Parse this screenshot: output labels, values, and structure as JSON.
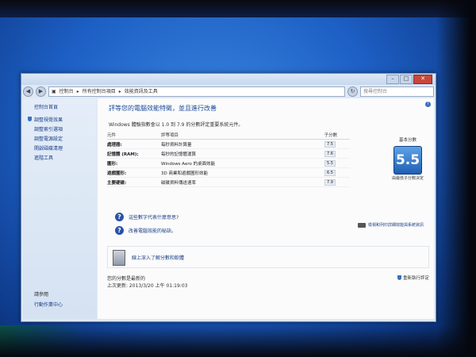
{
  "window": {
    "breadcrumb": [
      "控制台",
      "所有控制台項目",
      "效能資訊及工具"
    ],
    "search_placeholder": "搜尋控制台"
  },
  "sidebar": {
    "home": "控制台首頁",
    "items": [
      {
        "label": "調整視覺效果"
      },
      {
        "label": "調整索引選項"
      },
      {
        "label": "調整電源設定"
      },
      {
        "label": "開啟磁碟清理"
      },
      {
        "label": "進階工具"
      }
    ],
    "see_also": "請參閱",
    "action_center": "行動作業中心"
  },
  "main": {
    "heading": "評等您的電腦效能特徵，並且進行改善",
    "subtitle": "Windows 體驗指數會以 1.0 到 7.9 的分數評定重要系統元件。",
    "table": {
      "headers": {
        "component": "元件",
        "rated": "評等項目",
        "subscore": "子分數",
        "base": "基本分數"
      },
      "rows": [
        {
          "component": "處理器:",
          "desc": "每秒資料計算量",
          "score": "7.5"
        },
        {
          "component": "記憶體 (RAM):",
          "desc": "每秒的記憶體運算",
          "score": "7.6"
        },
        {
          "component": "圖形:",
          "desc": "Windows Aero 的桌面效能",
          "score": "5.5"
        },
        {
          "component": "遊戲圖形:",
          "desc": "3D 商業和遊戲圖形效能",
          "score": "6.5"
        },
        {
          "component": "主要硬碟:",
          "desc": "磁碟資料傳送速率",
          "score": "7.9"
        }
      ],
      "base_score": "5.5",
      "base_caption": "由最低子分數決定"
    },
    "links": {
      "what_means": "這些數字代表什麼意思?",
      "improve": "改善電腦效能的秘訣。",
      "print": "檢視和列印詳細效能與系統資訊",
      "learn_more": "線上深入了解分數和軟體"
    },
    "footer": {
      "current_label": "您的分數是最新的",
      "last_update": "上次更新: 2013/3/20 上午 01:19:03",
      "rerun": "重新執行評定"
    }
  }
}
